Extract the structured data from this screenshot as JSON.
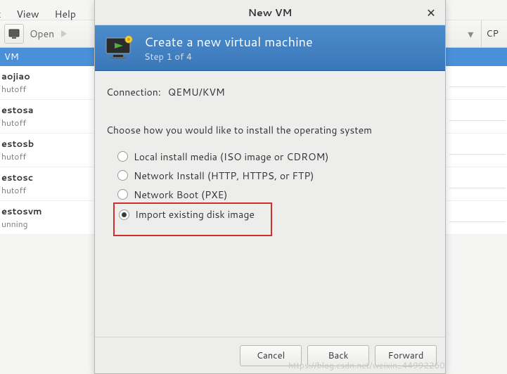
{
  "main": {
    "menu": {
      "edit_partial": "t",
      "view": "View",
      "help": "Help"
    },
    "toolbar": {
      "open": "Open",
      "cpu_col": "CP"
    },
    "list_header": "VM",
    "vms": [
      {
        "name": "aojiao",
        "status": "hutoff"
      },
      {
        "name": "estosa",
        "status": "hutoff"
      },
      {
        "name": "estosb",
        "status": "hutoff"
      },
      {
        "name": "estosc",
        "status": "hutoff"
      },
      {
        "name": "estosvm",
        "status": "unning"
      }
    ]
  },
  "dialog": {
    "title": "New VM",
    "header_title": "Create a new virtual machine",
    "step": "Step 1 of 4",
    "connection_label": "Connection:",
    "connection_value": "QEMU/KVM",
    "prompt": "Choose how you would like to install the operating system",
    "options": {
      "local": "Local install media (ISO image or CDROM)",
      "network_install": "Network Install (HTTP, HTTPS, or FTP)",
      "network_boot": "Network Boot (PXE)",
      "import_disk": "Import existing disk image"
    },
    "selected": "import_disk",
    "buttons": {
      "cancel": "Cancel",
      "back": "Back",
      "forward": "Forward"
    }
  },
  "watermark": "https://blog.csdn.net/weixin_44992260"
}
